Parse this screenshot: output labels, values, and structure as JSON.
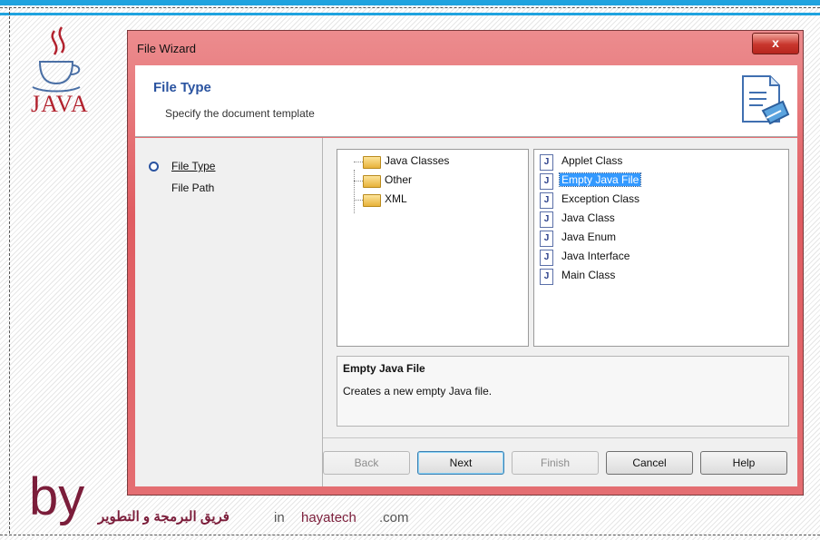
{
  "colors": {
    "accent_blue": "#1fa3df",
    "window_frame": "#e05c61",
    "header_title": "#2a53a0",
    "selection": "#3399ff",
    "brand_maroon": "#7b1d3a"
  },
  "logo": {
    "text": "JAVA"
  },
  "window": {
    "title": "File Wizard",
    "close_label": "x",
    "header": {
      "title": "File Type",
      "subtitle": "Specify the document template",
      "icon": "document-wizard-icon"
    },
    "steps": [
      {
        "label": "File Type",
        "active": true
      },
      {
        "label": "File Path",
        "active": false
      }
    ],
    "tree": [
      {
        "label": "Java Classes",
        "icon": "folder-icon"
      },
      {
        "label": "Other",
        "icon": "folder-icon"
      },
      {
        "label": "XML",
        "icon": "folder-icon"
      }
    ],
    "templates": [
      {
        "label": "Applet Class",
        "icon": "java-file-icon"
      },
      {
        "label": "Empty Java File",
        "icon": "java-file-icon",
        "selected": true
      },
      {
        "label": "Exception Class",
        "icon": "java-file-icon"
      },
      {
        "label": "Java Class",
        "icon": "java-file-icon"
      },
      {
        "label": "Java Enum",
        "icon": "java-file-icon"
      },
      {
        "label": "Java Interface",
        "icon": "java-file-icon"
      },
      {
        "label": "Main Class",
        "icon": "java-file-icon"
      }
    ],
    "description": {
      "title": "Empty Java File",
      "text": "Creates a new empty Java file."
    },
    "buttons": {
      "back": "Back",
      "next": "Next",
      "finish": "Finish",
      "cancel": "Cancel",
      "help": "Help"
    }
  },
  "footer": {
    "by": "by",
    "team": "فريق البرمجة و التطوير",
    "in": "in",
    "site": "hayatech",
    "tld": ".com"
  }
}
